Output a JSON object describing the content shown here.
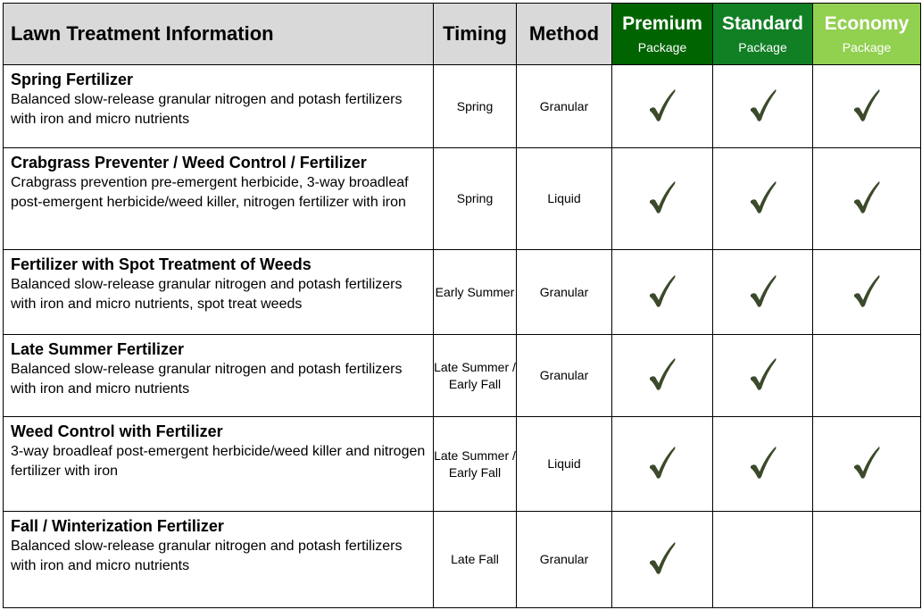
{
  "table": {
    "headers": {
      "info": "Lawn Treatment Information",
      "timing": "Timing",
      "method": "Method"
    },
    "packages": [
      {
        "name": "Premium",
        "sub": "Package",
        "color": "#006400"
      },
      {
        "name": "Standard",
        "sub": "Package",
        "color": "#117f24"
      },
      {
        "name": "Economy",
        "sub": "Package",
        "color": "#92d050"
      }
    ],
    "check_icon": "check-mark-icon",
    "check_color": "#3b4a2a",
    "rows": [
      {
        "title": "Spring Fertilizer",
        "description": "Balanced slow-release granular nitrogen and potash fertilizers with iron and micro nutrients",
        "timing": "Spring",
        "method": "Granular",
        "premium": true,
        "standard": true,
        "economy": true
      },
      {
        "title": "Crabgrass Preventer / Weed Control / Fertilizer",
        "description": "Crabgrass prevention pre-emergent herbicide, 3-way broadleaf post-emergent herbicide/weed killer, nitrogen fertilizer with iron",
        "timing": "Spring",
        "method": "Liquid",
        "premium": true,
        "standard": true,
        "economy": true
      },
      {
        "title": "Fertilizer with Spot Treatment of Weeds",
        "description": "Balanced slow-release granular nitrogen and potash fertilizers with iron and micro nutrients, spot treat weeds",
        "timing": "Early Summer",
        "method": "Granular",
        "premium": true,
        "standard": true,
        "economy": true
      },
      {
        "title": "Late Summer Fertilizer",
        "description": "Balanced slow-release granular nitrogen and potash fertilizers with iron and micro nutrients",
        "timing": "Late Summer / Early Fall",
        "method": "Granular",
        "premium": true,
        "standard": true,
        "economy": false
      },
      {
        "title": "Weed Control with Fertilizer",
        "description": "3-way broadleaf post-emergent herbicide/weed killer and nitrogen fertilizer with iron",
        "timing": "Late Summer / Early Fall",
        "method": "Liquid",
        "premium": true,
        "standard": true,
        "economy": true
      },
      {
        "title": "Fall / Winterization Fertilizer",
        "description": "Balanced slow-release granular nitrogen and potash fertilizers with iron and micro nutrients",
        "timing": "Late Fall",
        "method": "Granular",
        "premium": true,
        "standard": false,
        "economy": false
      }
    ]
  }
}
